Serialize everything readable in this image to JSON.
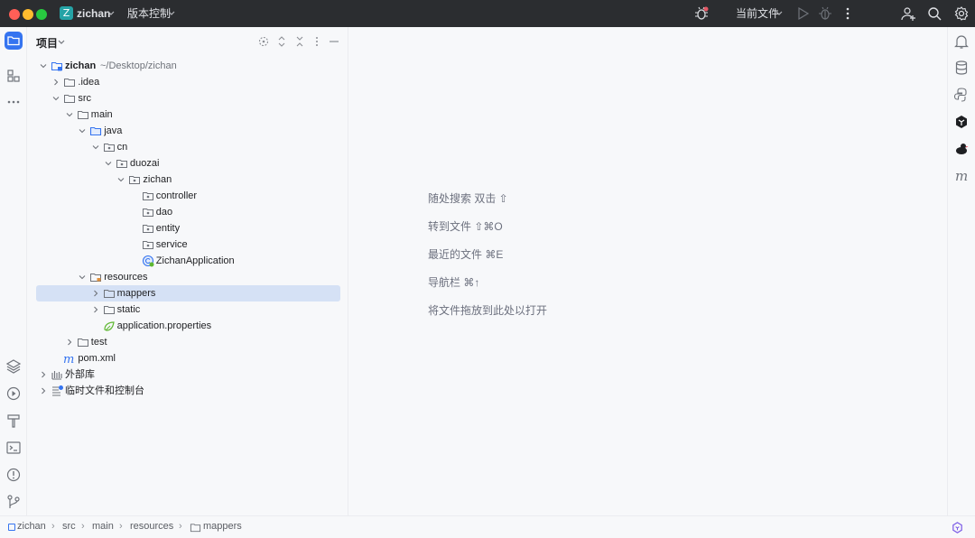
{
  "titlebar": {
    "project_badge": "Z",
    "project_name": "zichan",
    "vcs_label": "版本控制",
    "run_config": "当前文件",
    "icons": [
      "bug-run-icon",
      "play-icon",
      "debug-icon",
      "more-vertical-icon",
      "add-user-icon",
      "search-icon",
      "settings-icon"
    ]
  },
  "project_panel": {
    "title": "项目",
    "tools": [
      "locate-icon",
      "expand-all-icon",
      "collapse-all-icon",
      "options-icon",
      "hide-icon"
    ]
  },
  "tree": [
    {
      "label": "zichan",
      "hint": "~/Desktop/zichan",
      "bold": true,
      "icon": "module-folder-icon",
      "expanded": true
    },
    {
      "label": ".idea",
      "icon": "folder-icon",
      "expanded": false
    },
    {
      "label": "src",
      "icon": "folder-icon",
      "expanded": true
    },
    {
      "label": "main",
      "icon": "folder-icon",
      "expanded": true
    },
    {
      "label": "java",
      "icon": "source-folder-icon",
      "expanded": true
    },
    {
      "label": "cn",
      "icon": "package-icon",
      "expanded": true
    },
    {
      "label": "duozai",
      "icon": "package-icon",
      "expanded": true
    },
    {
      "label": "zichan",
      "icon": "package-icon",
      "expanded": true
    },
    {
      "label": "controller",
      "icon": "package-icon"
    },
    {
      "label": "dao",
      "icon": "package-icon"
    },
    {
      "label": "entity",
      "icon": "package-icon"
    },
    {
      "label": "service",
      "icon": "package-icon"
    },
    {
      "label": "ZichanApplication",
      "icon": "spring-class-icon"
    },
    {
      "label": "resources",
      "icon": "resources-folder-icon",
      "expanded": true
    },
    {
      "label": "mappers",
      "icon": "folder-icon",
      "expanded": false,
      "selected": true
    },
    {
      "label": "static",
      "icon": "folder-icon",
      "expanded": false
    },
    {
      "label": "application.properties",
      "icon": "spring-properties-icon"
    },
    {
      "label": "test",
      "icon": "folder-icon",
      "expanded": false
    },
    {
      "label": "pom.xml",
      "icon": "maven-icon"
    },
    {
      "label": "外部库",
      "icon": "library-icon",
      "expanded": false
    },
    {
      "label": "临时文件和控制台",
      "icon": "scratches-icon",
      "expanded": false
    }
  ],
  "editor_hints": [
    "随处搜索 双击 ⇧",
    "转到文件 ⇧⌘O",
    "最近的文件 ⌘E",
    "导航栏 ⌘↑",
    "将文件拖放到此处以打开"
  ],
  "left_toolbar": [
    "project-icon",
    "structure-icon",
    "more-horizontal-icon",
    "layers-icon",
    "services-icon",
    "build-icon",
    "terminal-icon",
    "problems-icon",
    "git-icon"
  ],
  "right_toolbar": [
    "notifications-icon",
    "database-icon",
    "python-icon",
    "ai-assistant-icon",
    "duck-plugin-icon",
    "maven-m-icon"
  ],
  "breadcrumb": [
    "zichan",
    "src",
    "main",
    "resources",
    "mappers"
  ],
  "colors": {
    "titlebar_bg": "#2b2d30",
    "selection": "#d5e1f5",
    "accent": "#3574f0",
    "badge": "#25a3a6"
  }
}
